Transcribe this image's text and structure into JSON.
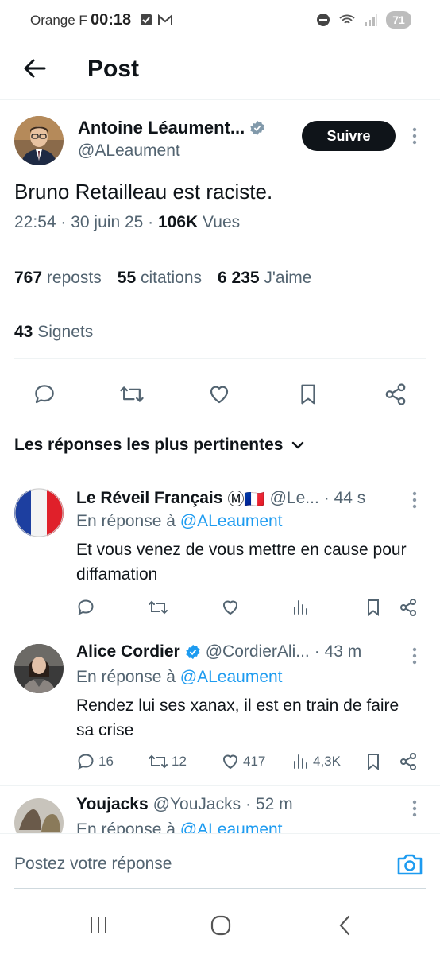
{
  "status_bar": {
    "carrier": "Orange F",
    "time": "00:18",
    "battery_label": "71"
  },
  "header": {
    "title": "Post"
  },
  "tweet": {
    "author_name": "Antoine Léaument...",
    "author_handle": "@ALeaument",
    "follow_label": "Suivre",
    "text": "Bruno Retailleau est raciste.",
    "time": "22:54",
    "date": "30 juin 25",
    "views_count": "106K",
    "views_label": "Vues",
    "reposts_count": "767",
    "reposts_label": "reposts",
    "quotes_count": "55",
    "quotes_label": "citations",
    "likes_count": "6 235",
    "likes_label": "J'aime",
    "bookmarks_count": "43",
    "bookmarks_label": "Signets"
  },
  "replies_section": {
    "sort_label": "Les réponses les plus pertinentes"
  },
  "replies": [
    {
      "name": "Le Réveil Français",
      "badges": "Ⓜ🇫🇷",
      "handle": "@Le...",
      "time": "· 44 s",
      "replying_prefix": "En réponse à",
      "replying_to": "@ALeaument",
      "text": "Et vous venez de vous mettre en cause pour diffamation",
      "reply_count": "",
      "repost_count": "",
      "like_count": "",
      "view_count": ""
    },
    {
      "name": "Alice Cordier",
      "handle": "@CordierAli...",
      "time": "· 43 m",
      "replying_prefix": "En réponse à",
      "replying_to": "@ALeaument",
      "text": "Rendez lui ses xanax, il est en train de faire sa crise",
      "reply_count": "16",
      "repost_count": "12",
      "like_count": "417",
      "view_count": "4,3K"
    },
    {
      "name": "Youjacks",
      "handle": "@YouJacks",
      "time": "· 52 m",
      "replying_prefix": "En réponse à",
      "replying_to": "@ALeaument"
    }
  ],
  "compose": {
    "placeholder": "Postez votre réponse"
  },
  "colors": {
    "accent": "#1d9bf0",
    "text": "#0f1419",
    "muted": "#536471",
    "divider": "#eff3f4"
  }
}
